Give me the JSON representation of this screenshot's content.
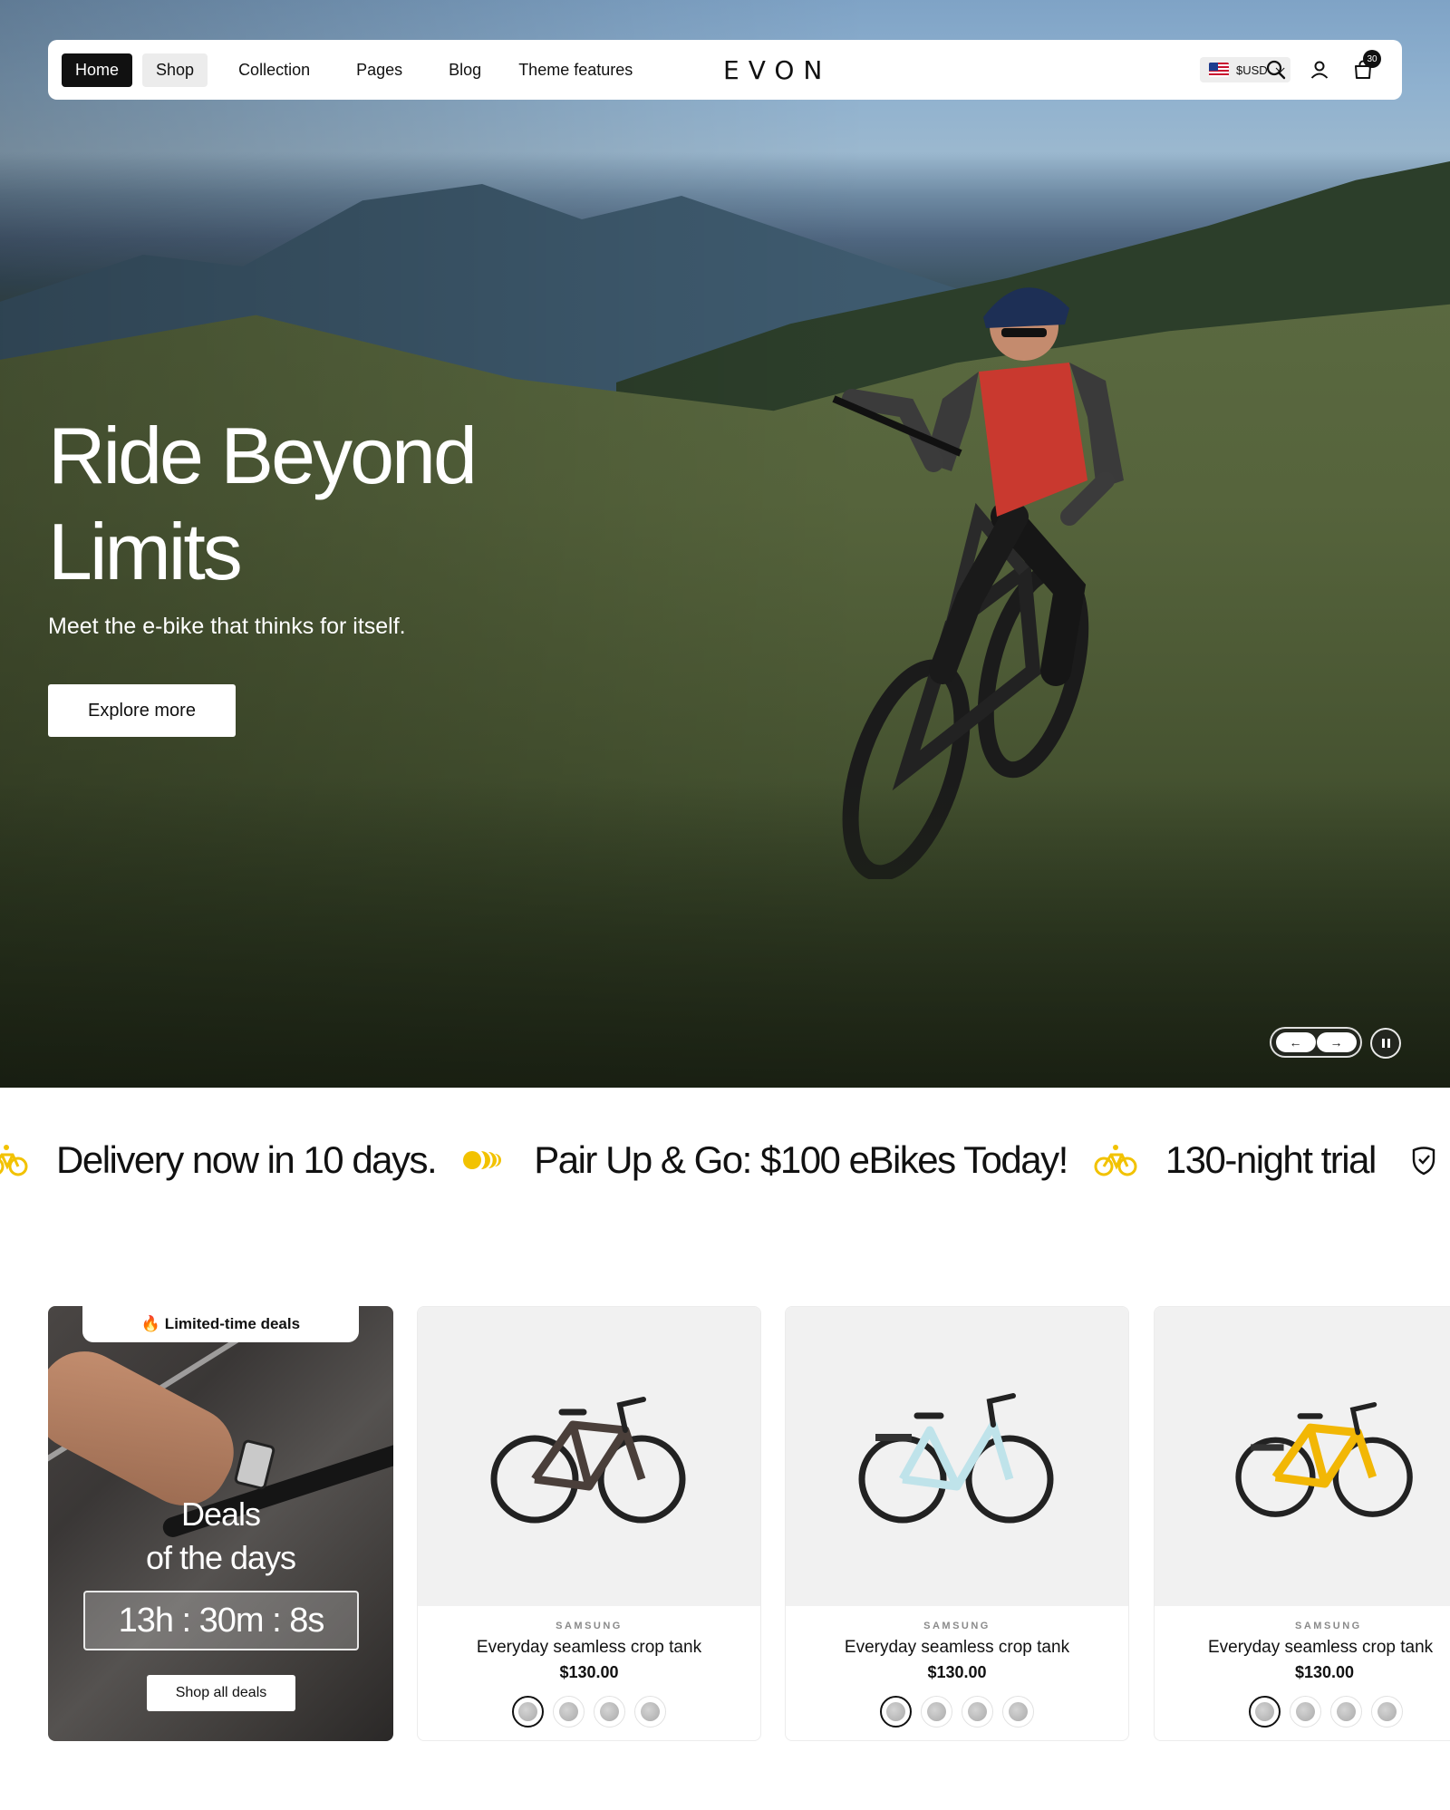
{
  "nav": {
    "links": [
      "Home",
      "Shop",
      "Collection",
      "Pages",
      "Blog",
      "Theme features"
    ],
    "logo": "EVON",
    "currency": "$USD",
    "cart_count": "30"
  },
  "hero": {
    "title_line1": "Ride Beyond",
    "title_line2": "Limits",
    "subtitle": "Meet the e-bike that thinks for itself.",
    "cta": "Explore more",
    "prev_label": "←",
    "next_label": "→"
  },
  "marquee": {
    "items": [
      "Delivery now in 10 days.",
      "Pair Up & Go: $100 eBikes Today!",
      "130-night trial"
    ],
    "accent_color": "#f2c200"
  },
  "deals": {
    "badge": "🔥 Limited-time deals",
    "title_line1": "Deals",
    "title_line2": "of the days",
    "timer": "13h : 30m : 8s",
    "cta": "Shop all deals"
  },
  "products": [
    {
      "brand": "SAMSUNG",
      "name": "Everyday seamless crop tank",
      "price": "$130.00",
      "frame_color": "#4a3f3a"
    },
    {
      "brand": "SAMSUNG",
      "name": "Everyday seamless crop tank",
      "price": "$130.00",
      "frame_color": "#bfe3ea"
    },
    {
      "brand": "SAMSUNG",
      "name": "Everyday seamless crop tank",
      "price": "$130.00",
      "frame_color": "#f2b705"
    }
  ]
}
